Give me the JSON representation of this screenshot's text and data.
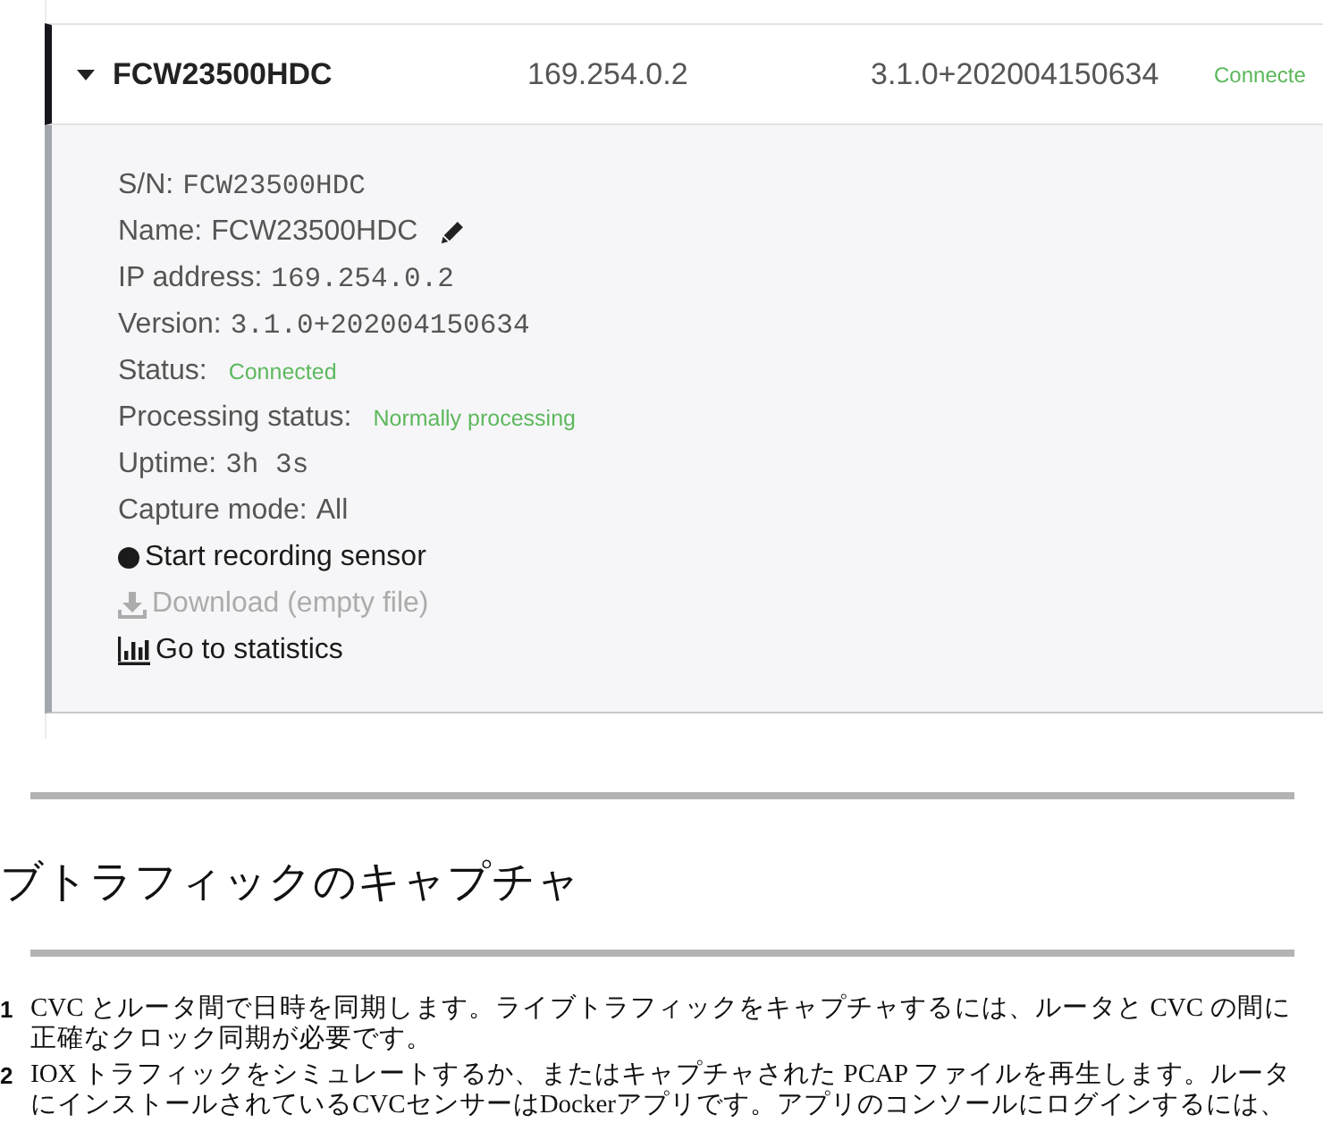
{
  "device": {
    "expanded": true,
    "name": "FCW23500HDC",
    "ip": "169.254.0.2",
    "version": "3.1.0+202004150634",
    "status": "Connecte"
  },
  "details": [
    {
      "kind": "mono",
      "label": "S/N:",
      "value": "FCW23500HDC"
    },
    {
      "kind": "editable",
      "label": "Name:",
      "value": "FCW23500HDC"
    },
    {
      "kind": "mono",
      "label": "IP address:",
      "value": "169.254.0.2"
    },
    {
      "kind": "mono",
      "label": "Version:",
      "value": "3.1.0+202004150634"
    },
    {
      "kind": "status",
      "label": "Status:",
      "value": "Connected"
    },
    {
      "kind": "status",
      "label": "Processing status:",
      "value": "Normally processing"
    },
    {
      "kind": "mono",
      "label": "Uptime:",
      "value": "3h 3s"
    },
    {
      "kind": "text",
      "label": "Capture mode:",
      "value": "All"
    }
  ],
  "actions": [
    {
      "kind": "record",
      "label": "Start recording sensor",
      "disabled": false
    },
    {
      "kind": "download",
      "label": "Download (empty file)",
      "disabled": true
    },
    {
      "kind": "statistics",
      "label": "Go to statistics",
      "disabled": false
    }
  ],
  "section": {
    "heading": "ブトラフィックのキャプチャ",
    "steps": [
      {
        "number": "1",
        "text": "CVC とルータ間で日時を同期します。ライブトラフィックをキャプチャするには、ルータと CVC の間に正確なクロック同期が必要です。"
      },
      {
        "number": "2",
        "text": "IOX トラフィックをシミュレートするか、またはキャプチャされた PCAP ファイルを再生します。ルータにインストールされているCVCセンサーはDockerアプリです。アプリのコンソールにログインするには、"
      }
    ]
  }
}
